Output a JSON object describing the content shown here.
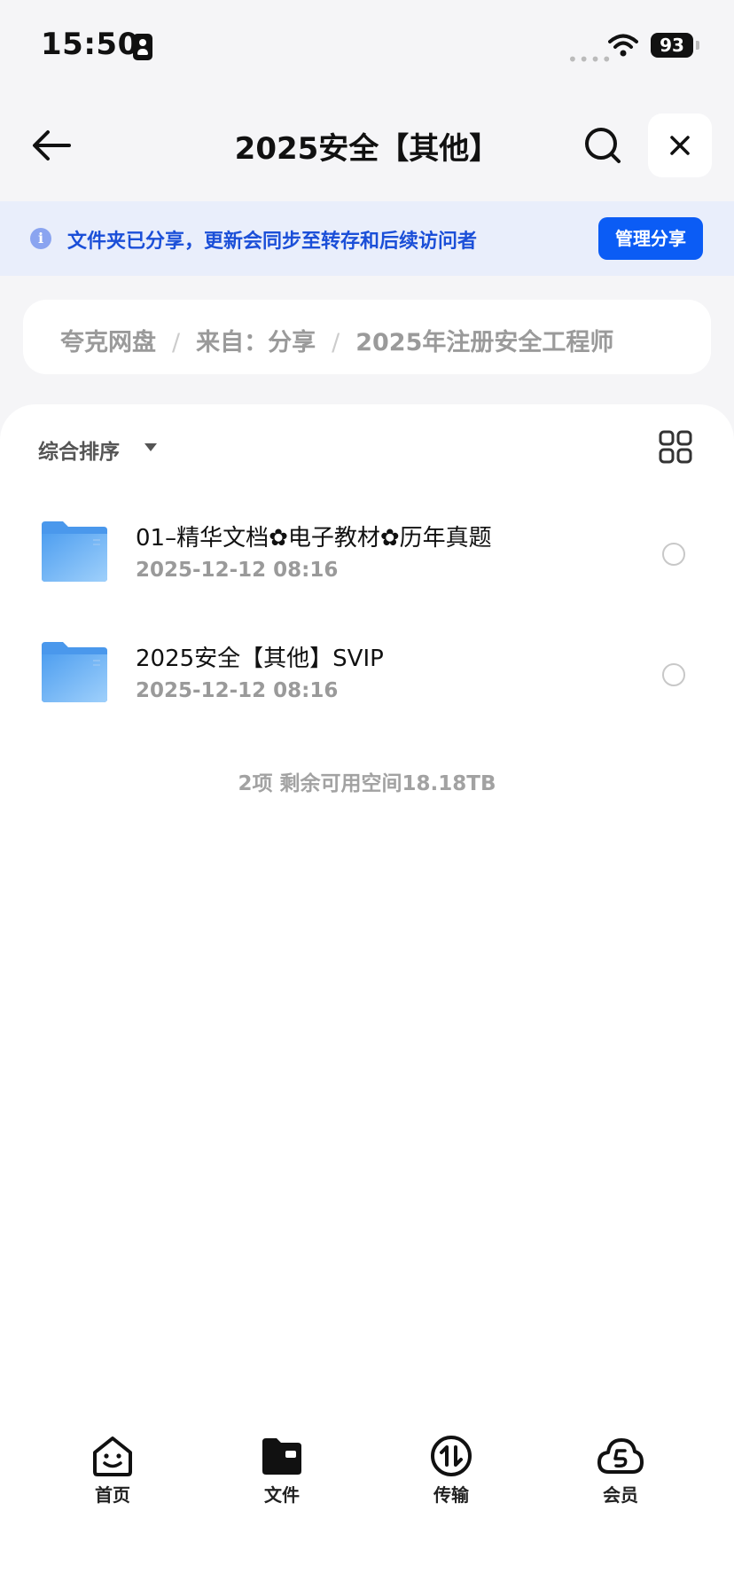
{
  "status_bar": {
    "time": "15:50",
    "signal": "••••",
    "battery": "93"
  },
  "nav": {
    "title": "2025安全【其他】"
  },
  "share_banner": {
    "text": "文件夹已分享，更新会同步至转存和后续访问者",
    "button": "管理分享"
  },
  "breadcrumb": {
    "items": [
      "夸克网盘",
      "来自：分享",
      "2025年注册安全工程师"
    ],
    "separator": "/"
  },
  "toolbar": {
    "sort_label": "综合排序"
  },
  "files": [
    {
      "name": "01–精华文档✿电子教材✿历年真题",
      "date": "2025-12-12 08:16"
    },
    {
      "name": "2025安全【其他】SVIP",
      "date": "2025-12-12 08:16"
    }
  ],
  "summary": "2项 剩余可用空间18.18TB",
  "tabbar": {
    "items": [
      {
        "label": "首页",
        "icon": "home-smile-icon"
      },
      {
        "label": "文件",
        "icon": "folder-wallet-icon"
      },
      {
        "label": "传输",
        "icon": "transfer-icon"
      },
      {
        "label": "会员",
        "icon": "member-cloud-icon"
      }
    ]
  },
  "colors": {
    "accent": "#0b5cf5",
    "banner_bg": "#e9eefb",
    "banner_text": "#1b4fd8",
    "folder": "#5aa8f0"
  }
}
